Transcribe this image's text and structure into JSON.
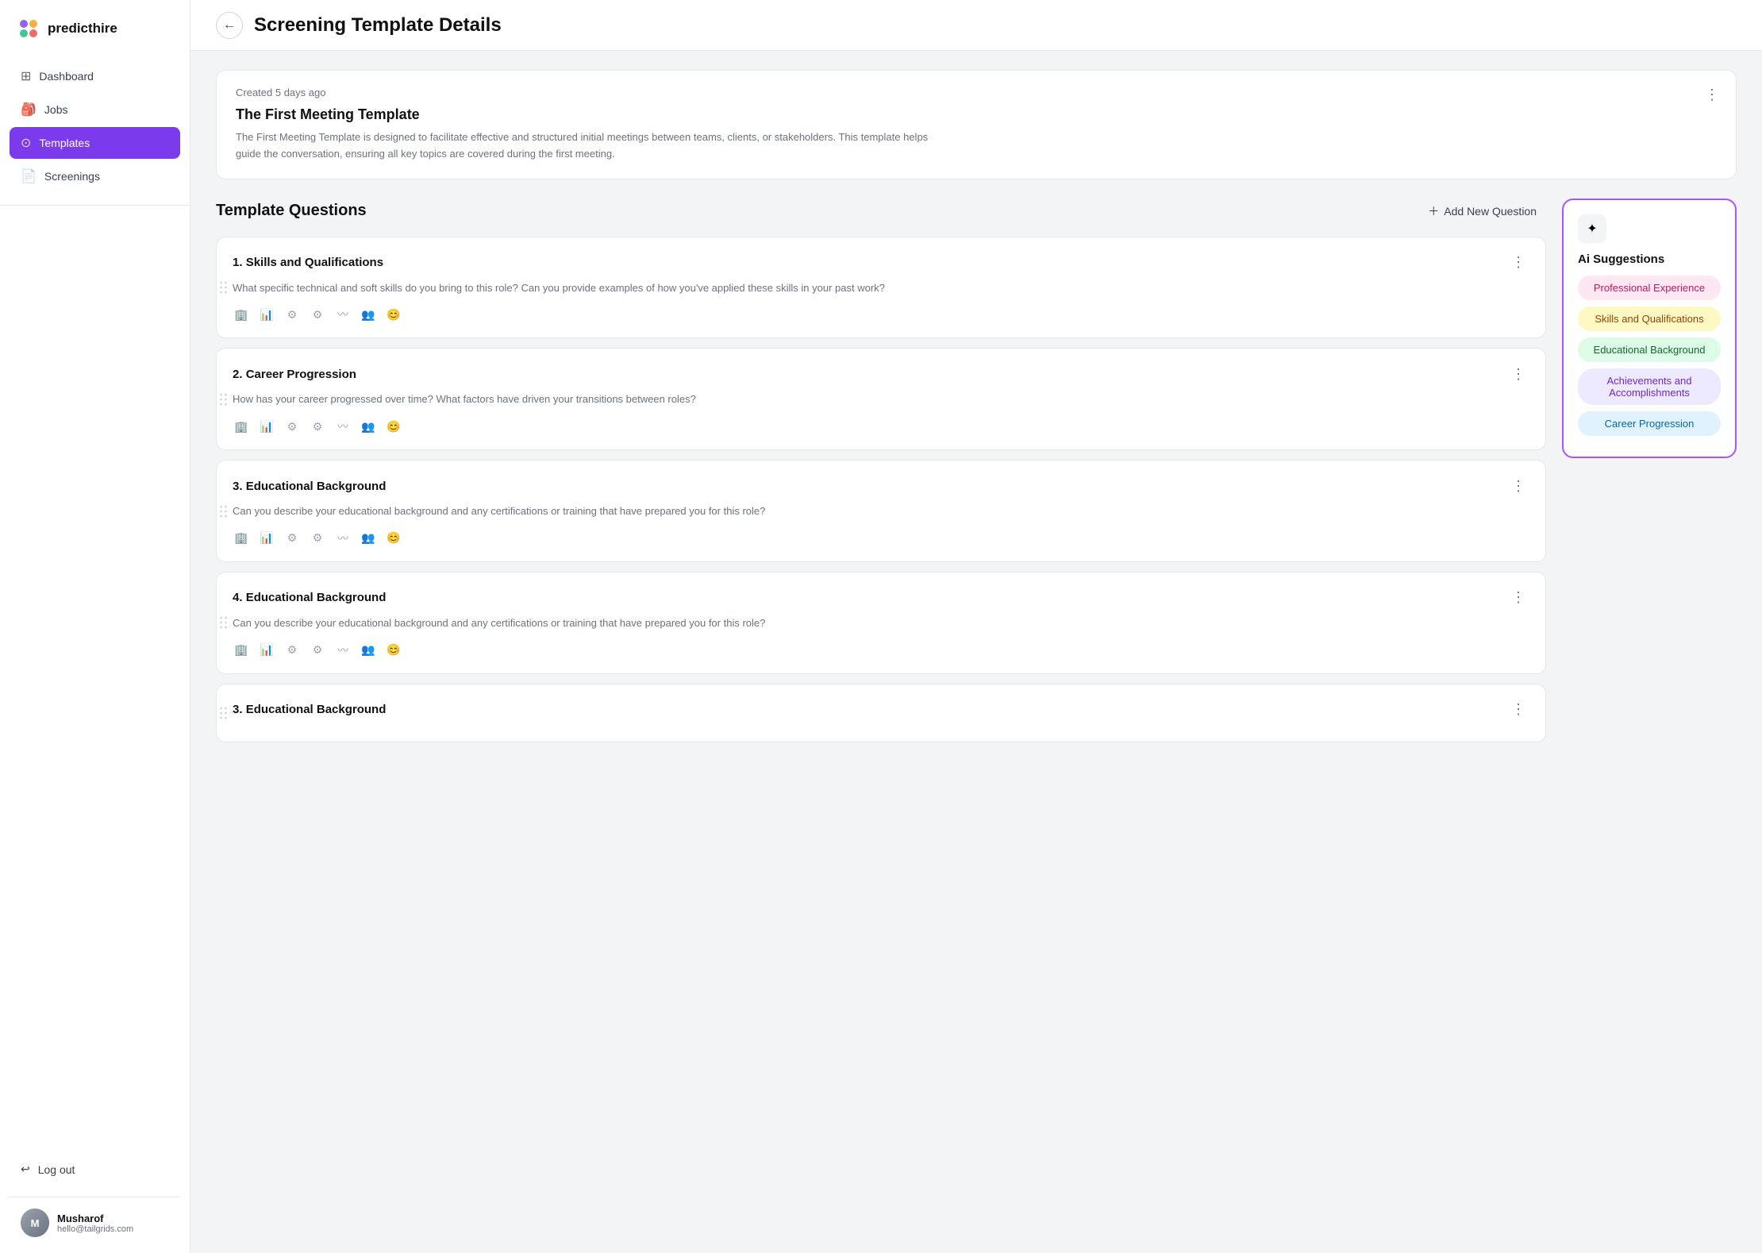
{
  "app": {
    "name": "predicthire"
  },
  "sidebar": {
    "nav_items": [
      {
        "id": "dashboard",
        "label": "Dashboard",
        "icon": "⊞",
        "active": false
      },
      {
        "id": "jobs",
        "label": "Jobs",
        "icon": "🎒",
        "active": false
      },
      {
        "id": "templates",
        "label": "Templates",
        "icon": "⊙",
        "active": true
      },
      {
        "id": "screenings",
        "label": "Screenings",
        "icon": "📄",
        "active": false
      }
    ],
    "logout_label": "Log out",
    "user": {
      "name": "Musharof",
      "email": "hello@tailgrids.com"
    }
  },
  "header": {
    "title": "Screening Template Details",
    "back_label": "←"
  },
  "template_info": {
    "timestamp": "Created 5 days ago",
    "name": "The First Meeting Template",
    "description": "The First Meeting Template is designed to facilitate effective and structured initial meetings between teams, clients, or stakeholders. This template helps guide the conversation, ensuring all key topics are covered during the first meeting."
  },
  "questions_section": {
    "title": "Template Questions",
    "add_button_label": "Add New Question",
    "questions": [
      {
        "number": "1.",
        "title": "Skills and Qualifications",
        "text": "What specific technical and soft skills do you bring to this role? Can you provide examples of how you've applied these skills in your past work?"
      },
      {
        "number": "2.",
        "title": "Career Progression",
        "text": "How has your career progressed over time? What factors have driven your transitions between roles?"
      },
      {
        "number": "3.",
        "title": "Educational Background",
        "text": "Can you describe your educational background and any certifications or training that have prepared you for this role?"
      },
      {
        "number": "4.",
        "title": "Educational Background",
        "text": "Can you describe your educational background and any certifications or training that have prepared you for this role?"
      },
      {
        "number": "3.",
        "title": "Educational Background",
        "text": ""
      }
    ]
  },
  "ai_suggestions": {
    "title": "Ai Suggestions",
    "chips": [
      {
        "label": "Professional Experience",
        "color": "pink"
      },
      {
        "label": "Skills and Qualifications",
        "color": "yellow"
      },
      {
        "label": "Educational Background",
        "color": "green"
      },
      {
        "label": "Achievements and Accomplishments",
        "color": "purple"
      },
      {
        "label": "Career Progression",
        "color": "blue"
      }
    ]
  }
}
